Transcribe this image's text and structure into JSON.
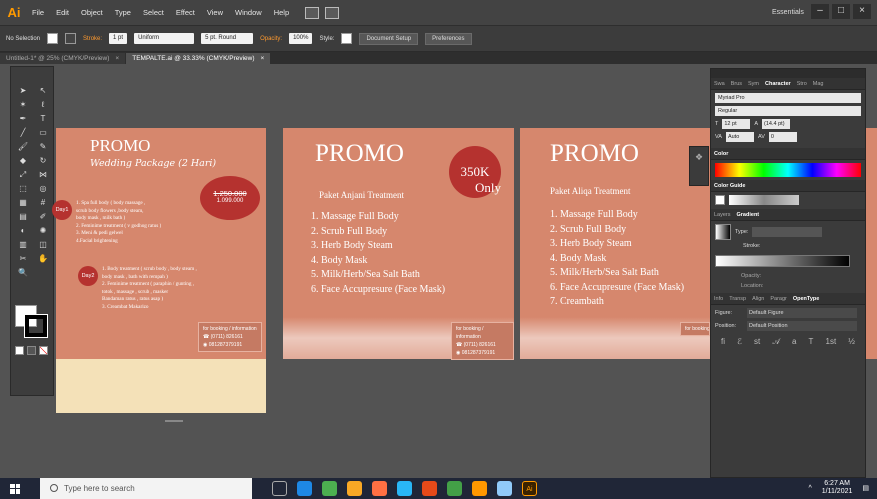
{
  "app": {
    "logo": "Ai",
    "workspace": "Essentials"
  },
  "menu": [
    "File",
    "Edit",
    "Object",
    "Type",
    "Select",
    "Effect",
    "View",
    "Window",
    "Help"
  ],
  "control_bar": {
    "selection": "No Selection",
    "stroke_label": "Stroke:",
    "stroke_weight": "1 pt",
    "profile": "Uniform",
    "brush": "5 pt. Round",
    "opacity_label": "Opacity:",
    "opacity": "100%",
    "style_label": "Style:",
    "doc_setup": "Document Setup",
    "preferences": "Preferences"
  },
  "tabs": [
    {
      "label": "Untitled-1* @ 25% (CMYK/Preview)"
    },
    {
      "label": "TEMPALTE.ai @ 33.33% (CMYK/Preview)"
    }
  ],
  "artboard1": {
    "title": "PROMO",
    "subtitle": "Wedding Package (2 Hari)",
    "old_price": "1.250.000",
    "new_price": "1.099.000",
    "day1": "Day1",
    "day2": "Day2",
    "list1": [
      "1. Spa full body ( body massage ,",
      "   scrub body  flowers ,body steam,",
      "   body mask , milk bath )",
      "2. Feminime treatment ( v godhog ratus )",
      "3. Meni & pedi gelwel",
      "4.Facial brightening"
    ],
    "list2": [
      "1. Body treatment ( scrub  body , body steam ,",
      "   body mask , bath with rempah )",
      "2. Feminime treatment ( paraphin / gunting ,",
      "   totok , massage , scrub , masker",
      "   Bandaman ratus , ratus asap )",
      "3. Creambat Makarizo"
    ],
    "contact_head": "for booking / information",
    "phone": "(0711) 826161",
    "wa": "081287379191"
  },
  "artboard2": {
    "title": "PROMO",
    "price": "350K",
    "only": "Only",
    "subtitle": "Paket Anjani Treatment",
    "items": [
      "1. Massage Full Body",
      "2. Scrub Full Body",
      "3. Herb Body Steam",
      "4. Body Mask",
      "5. Milk/Herb/Sea Salt Bath",
      "6. Face Accupresure (Face Mask)"
    ],
    "contact_head": "for booking / information",
    "phone": "(0711) 826161",
    "wa": "081287379191"
  },
  "artboard3": {
    "title": "PROMO",
    "subtitle": "Paket Aliqa Treatment",
    "items": [
      "1. Massage Full Body",
      "2. Scrub Full Body",
      "3. Herb Body Steam",
      "4. Body Mask",
      "5. Milk/Herb/Sea Salt Bath",
      "6. Face Accupresure (Face Mask)",
      "7. Creambath"
    ],
    "contact_head": "for booking / information"
  },
  "character_panel": {
    "tabs": [
      "Swa",
      "Brus",
      "Sym",
      "Character",
      "Stro",
      "Mag"
    ],
    "font": "Myriad Pro",
    "style": "Regular",
    "size": "12 pt",
    "leading": "(14.4 pt)",
    "kerning": "Auto",
    "tracking": "0"
  },
  "color_panel": {
    "title": "Color"
  },
  "color_guide": {
    "title": "Color Guide"
  },
  "gradient_panel": {
    "tabs": [
      "Layers",
      "Gradient"
    ],
    "type_label": "Type:",
    "stroke_label": "Stroke:",
    "opacity_label": "Opacity:",
    "location_label": "Location:"
  },
  "opentype_panel": {
    "tabs": [
      "Info",
      "Transp",
      "Align",
      "Paragr",
      "OpenType"
    ],
    "figure_label": "Figure:",
    "figure": "Default Figure",
    "position_label": "Position:",
    "position": "Default Position"
  },
  "taskbar": {
    "search": "Type here to search",
    "time": "6:27 AM",
    "date": "1/11/2021"
  }
}
